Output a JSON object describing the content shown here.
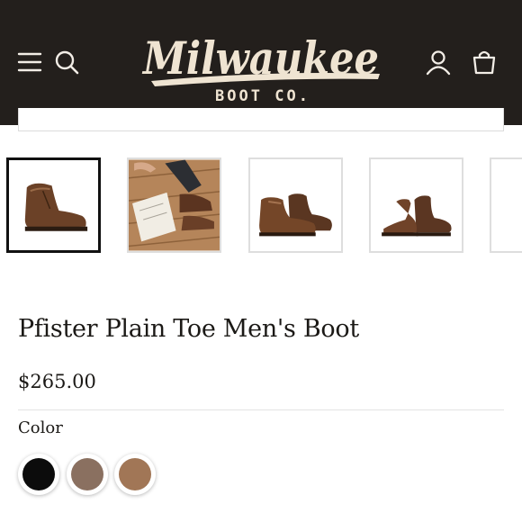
{
  "header": {
    "background": "#231f1c",
    "logo": {
      "script_text": "Milwaukee",
      "sub_text": "BOOT CO.",
      "color": "#efe4d2"
    },
    "icons": [
      "menu-icon",
      "search-icon",
      "account-icon",
      "cart-icon"
    ]
  },
  "gallery": {
    "thumbnails": [
      {
        "label": "boot-side-view",
        "active": true
      },
      {
        "label": "lifestyle-boots-on-wood-floor",
        "active": false
      },
      {
        "label": "boot-pair-side-view",
        "active": false
      },
      {
        "label": "boot-pair-front-view",
        "active": false
      },
      {
        "label": "partial-thumbnail",
        "active": false
      }
    ]
  },
  "product": {
    "title": "Pfister Plain Toe Men's Boot",
    "price": "$265.00",
    "color_label": "Color",
    "swatches": [
      {
        "name": "black",
        "color": "#0c0c0c"
      },
      {
        "name": "brown-grey",
        "color": "#8a7060"
      },
      {
        "name": "tan",
        "color": "#a17656"
      }
    ]
  }
}
